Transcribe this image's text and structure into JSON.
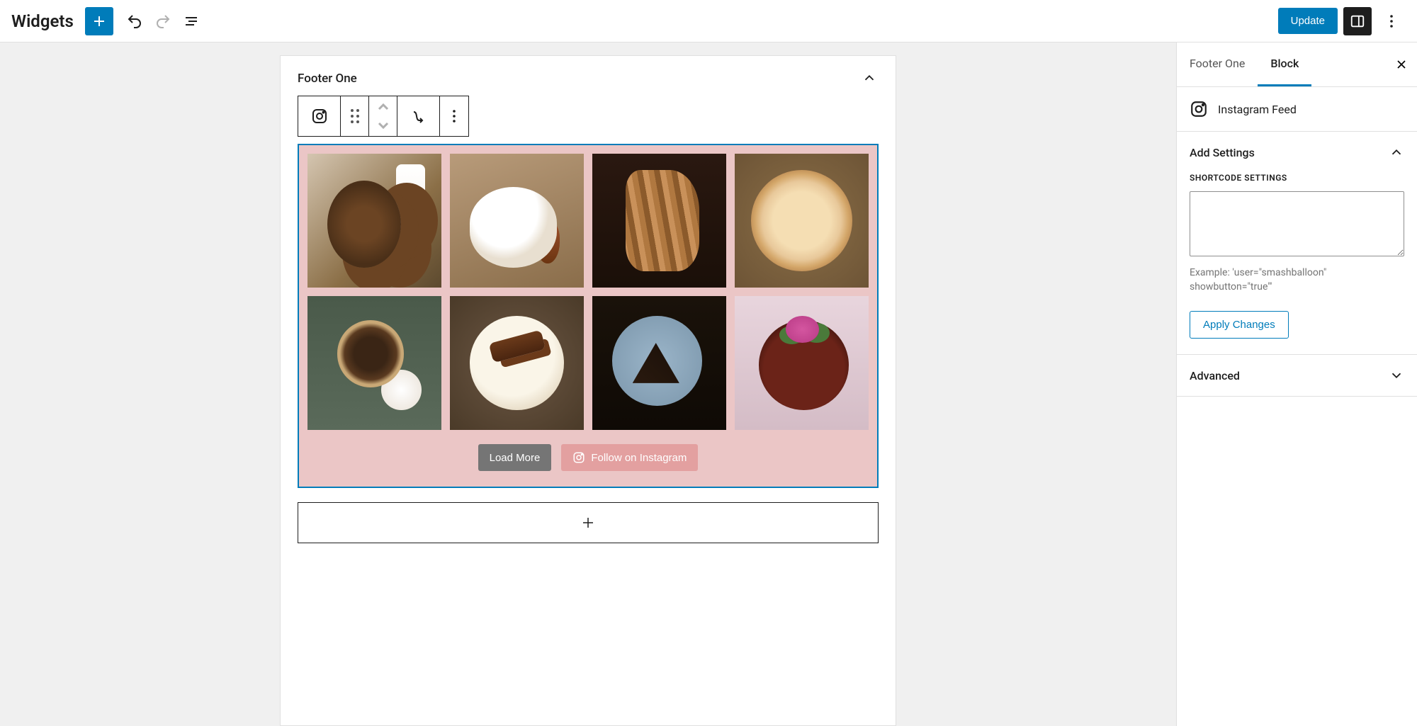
{
  "header": {
    "title": "Widgets",
    "update_label": "Update"
  },
  "widget_area": {
    "title": "Footer One",
    "load_more_label": "Load More",
    "follow_label": "Follow on Instagram"
  },
  "sidebar": {
    "tabs": {
      "area": "Footer One",
      "block": "Block"
    },
    "block_name": "Instagram Feed",
    "panels": {
      "add_settings": {
        "title": "Add Settings",
        "shortcode_label": "Shortcode Settings",
        "shortcode_value": "",
        "hint": "Example: 'user=\"smashballoon\" showbutton=\"true\"'",
        "apply_label": "Apply Changes"
      },
      "advanced": {
        "title": "Advanced"
      }
    }
  }
}
